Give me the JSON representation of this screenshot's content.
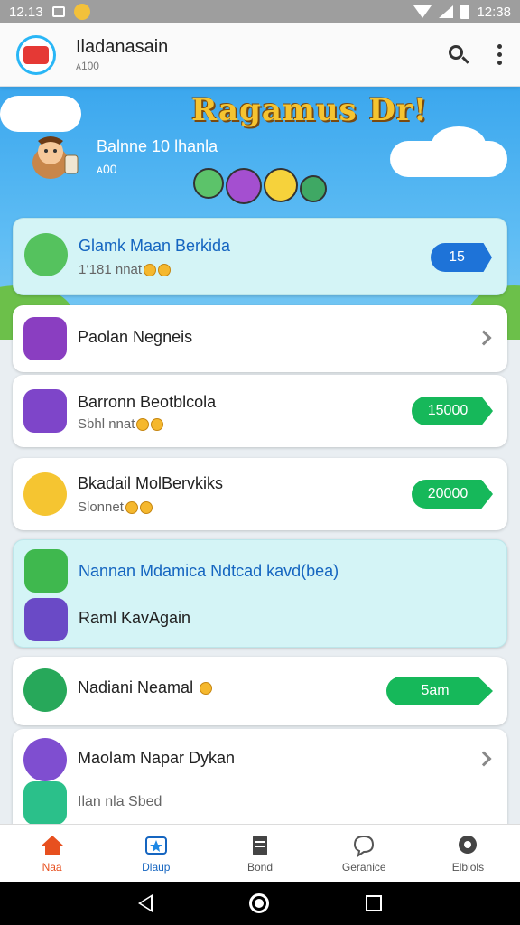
{
  "status_bar": {
    "time_left": "12.13",
    "time_right": "12:38"
  },
  "app_bar": {
    "title": "Iladanasain",
    "subtitle": "ᴀ100"
  },
  "banner": {
    "title": "Ragamus Dr!",
    "subtitle": "Balnne 10 lhanla",
    "count": "ᴀ00"
  },
  "items": [
    {
      "title": "Glamk Maan Berkida",
      "subtitle": "1‘181 nnat",
      "badge": "15"
    },
    {
      "title": "Paolan Negneis"
    },
    {
      "title": "Barronn Beotblcola",
      "subtitle": "Sbhl nnat",
      "badge": "15000"
    },
    {
      "title": "Bkadail MolBervkiks",
      "subtitle": "Slonnet",
      "badge": "20000"
    },
    {
      "title": "Nannan Mdamica Ndtcad kavd(bea)",
      "subtitle": "Raml KavAgain"
    },
    {
      "title": "Nadiani Neamal",
      "badge": "5am"
    },
    {
      "title": "Maolam Napar Dykan",
      "subtitle": "Ilan nla Sbed"
    }
  ],
  "bottom_nav": [
    {
      "label": "Naa"
    },
    {
      "label": "Dlaup"
    },
    {
      "label": "Bond"
    },
    {
      "label": "Geranice"
    },
    {
      "label": "Elbiols"
    }
  ],
  "colors": {
    "accent_blue": "#1e73d8",
    "accent_green": "#16b85a",
    "highlight": "#d4f4f6"
  }
}
